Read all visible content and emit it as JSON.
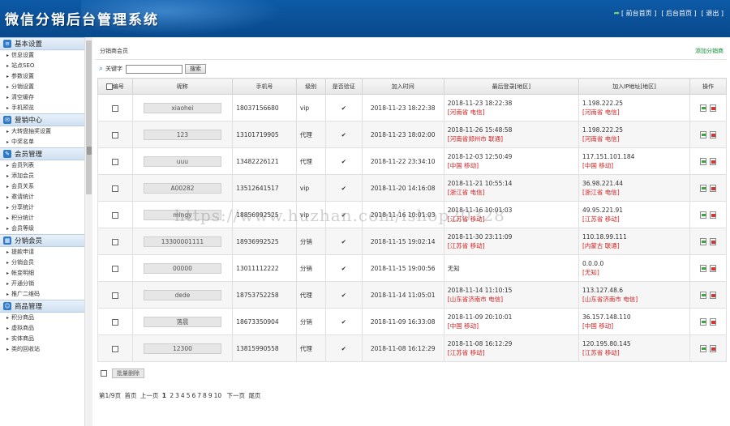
{
  "header": {
    "title": "微信分销后台管理系统",
    "links": [
      "[ 前台首页 ]",
      "[ 后台首页 ]",
      "[ 退出 ]"
    ]
  },
  "sidebar": {
    "sections": [
      {
        "title": "基本设置",
        "icon": "list-icon",
        "items": [
          "信息设置",
          "站点SEO",
          "参数设置",
          "分销设置",
          "清空缓存",
          "手机预览"
        ]
      },
      {
        "title": "营销中心",
        "icon": "chat-icon",
        "items": [
          "大转盘抽奖设置",
          "中奖名单"
        ]
      },
      {
        "title": "会员管理",
        "icon": "edit-icon",
        "items": [
          "会员列表",
          "添加会员",
          "会员关系",
          "邀请统计",
          "分享统计",
          "积分统计",
          "会员等级"
        ]
      },
      {
        "title": "分销会员",
        "icon": "grid-icon",
        "items": [
          "提款申请",
          "分销会员",
          "帐变明细",
          "开通分销",
          "推广二维码"
        ]
      },
      {
        "title": "商品管理",
        "icon": "user-icon",
        "items": [
          "积分商品",
          "虚拟商品",
          "实体商品",
          "类的回收站"
        ]
      }
    ]
  },
  "panel": {
    "title": "分销商会员",
    "add_label": "添加分销商"
  },
  "search": {
    "label": "关键字",
    "value": "",
    "button": "搜索"
  },
  "table": {
    "headers": [
      "编号",
      "昵称",
      "手机号",
      "级别",
      "是否验证",
      "加入时间",
      "最后登录[地区]",
      "加入IP地址[地区]",
      "操作"
    ],
    "rows": [
      {
        "nick": "xiaohei",
        "phone": "18037156680",
        "level": "vip",
        "joined": "2018-11-23 18:22:38",
        "login_time": "2018-11-23 18:22:38",
        "login_region": "[河南省 电信]",
        "ip": "1.198.222.25",
        "ip_region": "[河南省 电信]"
      },
      {
        "nick": "123",
        "phone": "13101719905",
        "level": "代理",
        "joined": "2018-11-23 18:02:00",
        "login_time": "2018-11-26 15:48:58",
        "login_region": "[河南省郑州市 联通]",
        "ip": "1.198.222.25",
        "ip_region": "[河南省 电信]"
      },
      {
        "nick": "uuu",
        "phone": "13482226121",
        "level": "代理",
        "joined": "2018-11-22 23:34:10",
        "login_time": "2018-12-03 12:50:49",
        "login_region": "[中国 移动]",
        "ip": "117.151.101.184",
        "ip_region": "[中国 移动]"
      },
      {
        "nick": "A00282",
        "phone": "13512641517",
        "level": "vip",
        "joined": "2018-11-20 14:16:08",
        "login_time": "2018-11-21 10:55:14",
        "login_region": "[浙江省 电信]",
        "ip": "36.98.221.44",
        "ip_region": "[浙江省 电信]"
      },
      {
        "nick": "mingy",
        "phone": "18856992525",
        "level": "vip",
        "joined": "2018-11-16 10:01:03",
        "login_time": "2018-11-16 10:01:03",
        "login_region": "[江苏省 移动]",
        "ip": "49.95.221.91",
        "ip_region": "[江苏省 移动]"
      },
      {
        "nick": "13300001111",
        "phone": "18936992525",
        "level": "分销",
        "joined": "2018-11-15 19:02:14",
        "login_time": "2018-11-30 23:11:09",
        "login_region": "[江苏省 移动]",
        "ip": "110.18.99.111",
        "ip_region": "[内蒙古 联通]"
      },
      {
        "nick": "00000",
        "phone": "13011112222",
        "level": "分销",
        "joined": "2018-11-15 19:00:56",
        "login_time": "无知",
        "login_region": "",
        "ip": "0.0.0.0",
        "ip_region": "[无知]"
      },
      {
        "nick": "dede",
        "phone": "18753752258",
        "level": "代理",
        "joined": "2018-11-14 11:05:01",
        "login_time": "2018-11-14 11:10:15",
        "login_region": "[山东省济南市 电信]",
        "ip": "113.127.48.6",
        "ip_region": "[山东省济南市 电信]"
      },
      {
        "nick": "落晨",
        "phone": "18673350904",
        "level": "分销",
        "joined": "2018-11-09 16:33:08",
        "login_time": "2018-11-09 20:10:01",
        "login_region": "[中国 移动]",
        "ip": "36.157.148.110",
        "ip_region": "[中国 移动]"
      },
      {
        "nick": "12300",
        "phone": "13815990558",
        "level": "代理",
        "joined": "2018-11-08 16:12:29",
        "login_time": "2018-11-08 16:12:29",
        "login_region": "[江苏省 移动]",
        "ip": "120.195.80.145",
        "ip_region": "[江苏省 移动]"
      }
    ]
  },
  "batch_delete_label": "批量删除",
  "pager": {
    "info": "第1/9页",
    "first": "首页",
    "prev": "上一页",
    "current": "1",
    "pages": [
      "2",
      "3",
      "4",
      "5",
      "6",
      "7",
      "8",
      "9",
      "10"
    ],
    "next": "下一页",
    "last": "尾页"
  },
  "watermark": "https://www.huzhan.com/ishop20328",
  "colors": {
    "header_bg": "#0d5aa7",
    "accent_red": "#d42020",
    "accent_green": "#0a8f2e"
  }
}
